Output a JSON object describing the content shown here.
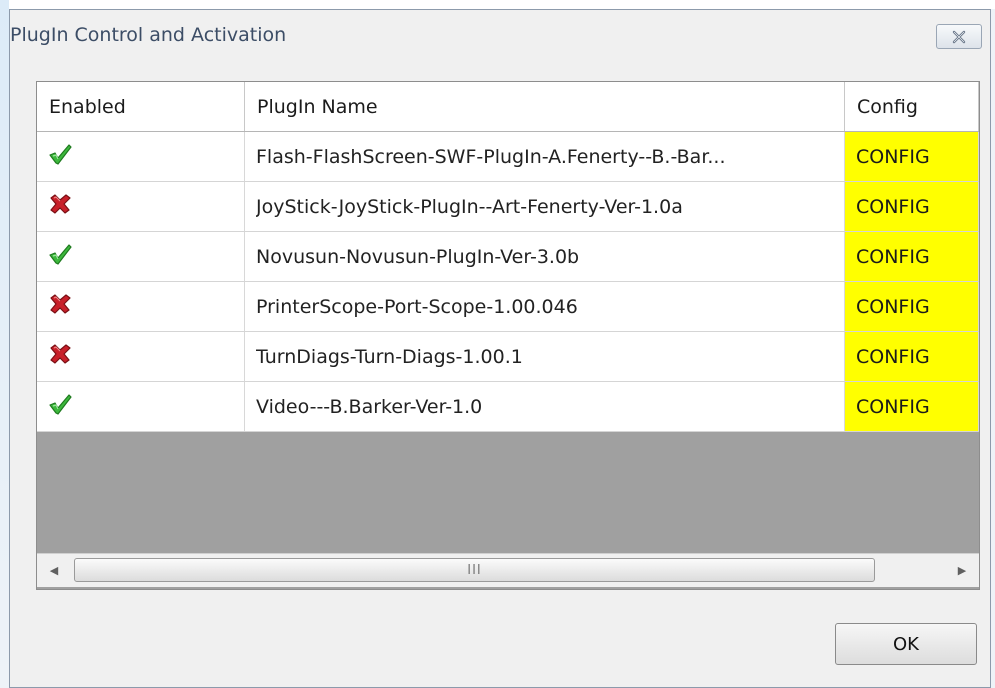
{
  "dialog": {
    "title": "PlugIn Control and Activation",
    "ok_label": "OK"
  },
  "table": {
    "headers": {
      "enabled": "Enabled",
      "name": "PlugIn Name",
      "config": "Config"
    },
    "rows": [
      {
        "enabled": true,
        "name": "Flash-FlashScreen-SWF-PlugIn-A.Fenerty--B.-Bar...",
        "config": "CONFIG"
      },
      {
        "enabled": false,
        "name": "JoyStick-JoyStick-PlugIn--Art-Fenerty-Ver-1.0a",
        "config": "CONFIG"
      },
      {
        "enabled": true,
        "name": "Novusun-Novusun-PlugIn-Ver-3.0b",
        "config": "CONFIG"
      },
      {
        "enabled": false,
        "name": "PrinterScope-Port-Scope-1.00.046",
        "config": "CONFIG"
      },
      {
        "enabled": false,
        "name": "TurnDiags-Turn-Diags-1.00.1",
        "config": "CONFIG"
      },
      {
        "enabled": true,
        "name": "Video---B.Barker-Ver-1.0",
        "config": "CONFIG"
      }
    ]
  },
  "scrollbar": {
    "grip": "III"
  },
  "colors": {
    "config_bg": "#ffff00",
    "enabled_icon": "#3cb83c",
    "disabled_icon": "#c8202a",
    "empty_area": "#a0a0a0"
  },
  "icons": {
    "enabled": "green-checkmark-icon",
    "disabled": "red-x-icon",
    "close": "close-icon",
    "scroll_left": "scroll-left-arrow-icon",
    "scroll_right": "scroll-right-arrow-icon"
  }
}
